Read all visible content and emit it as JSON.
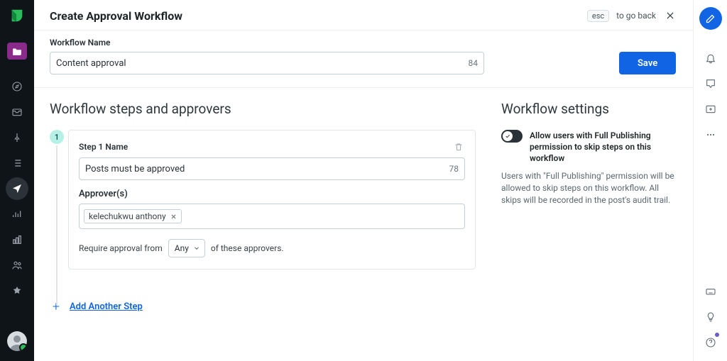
{
  "header": {
    "title": "Create Approval Workflow",
    "esc_key_label": "esc",
    "go_back_label": "to go back"
  },
  "workflow_name": {
    "label": "Workflow Name",
    "value": "Content approval",
    "remaining": "84"
  },
  "save_label": "Save",
  "steps_section_heading": "Workflow steps and approvers",
  "step1": {
    "badge": "1",
    "name_label": "Step 1 Name",
    "name_value": "Posts must be approved",
    "name_remaining": "78",
    "approvers_label": "Approver(s)",
    "approvers": [
      {
        "name": "kelechukwu anthony"
      }
    ],
    "require_prefix": "Require approval from",
    "require_select": "Any",
    "require_suffix": "of these approvers."
  },
  "add_step_label": "Add Another Step",
  "settings": {
    "heading": "Workflow settings",
    "toggle_label": "Allow users with Full Publishing permission to skip steps on this workflow",
    "description": "Users with \"Full Publishing\" permission will be allowed to skip steps on this workflow. All skips will be recorded in the post's audit trail."
  },
  "left_rail": {
    "items": [
      "logo",
      "folder",
      "compass",
      "inbox",
      "pin",
      "list",
      "send",
      "analytics",
      "bar-chart",
      "people",
      "star"
    ]
  },
  "right_rail": {
    "items": [
      "compose",
      "bell",
      "comment",
      "add-media",
      "more",
      "keyboard",
      "lightbulb",
      "help"
    ]
  }
}
